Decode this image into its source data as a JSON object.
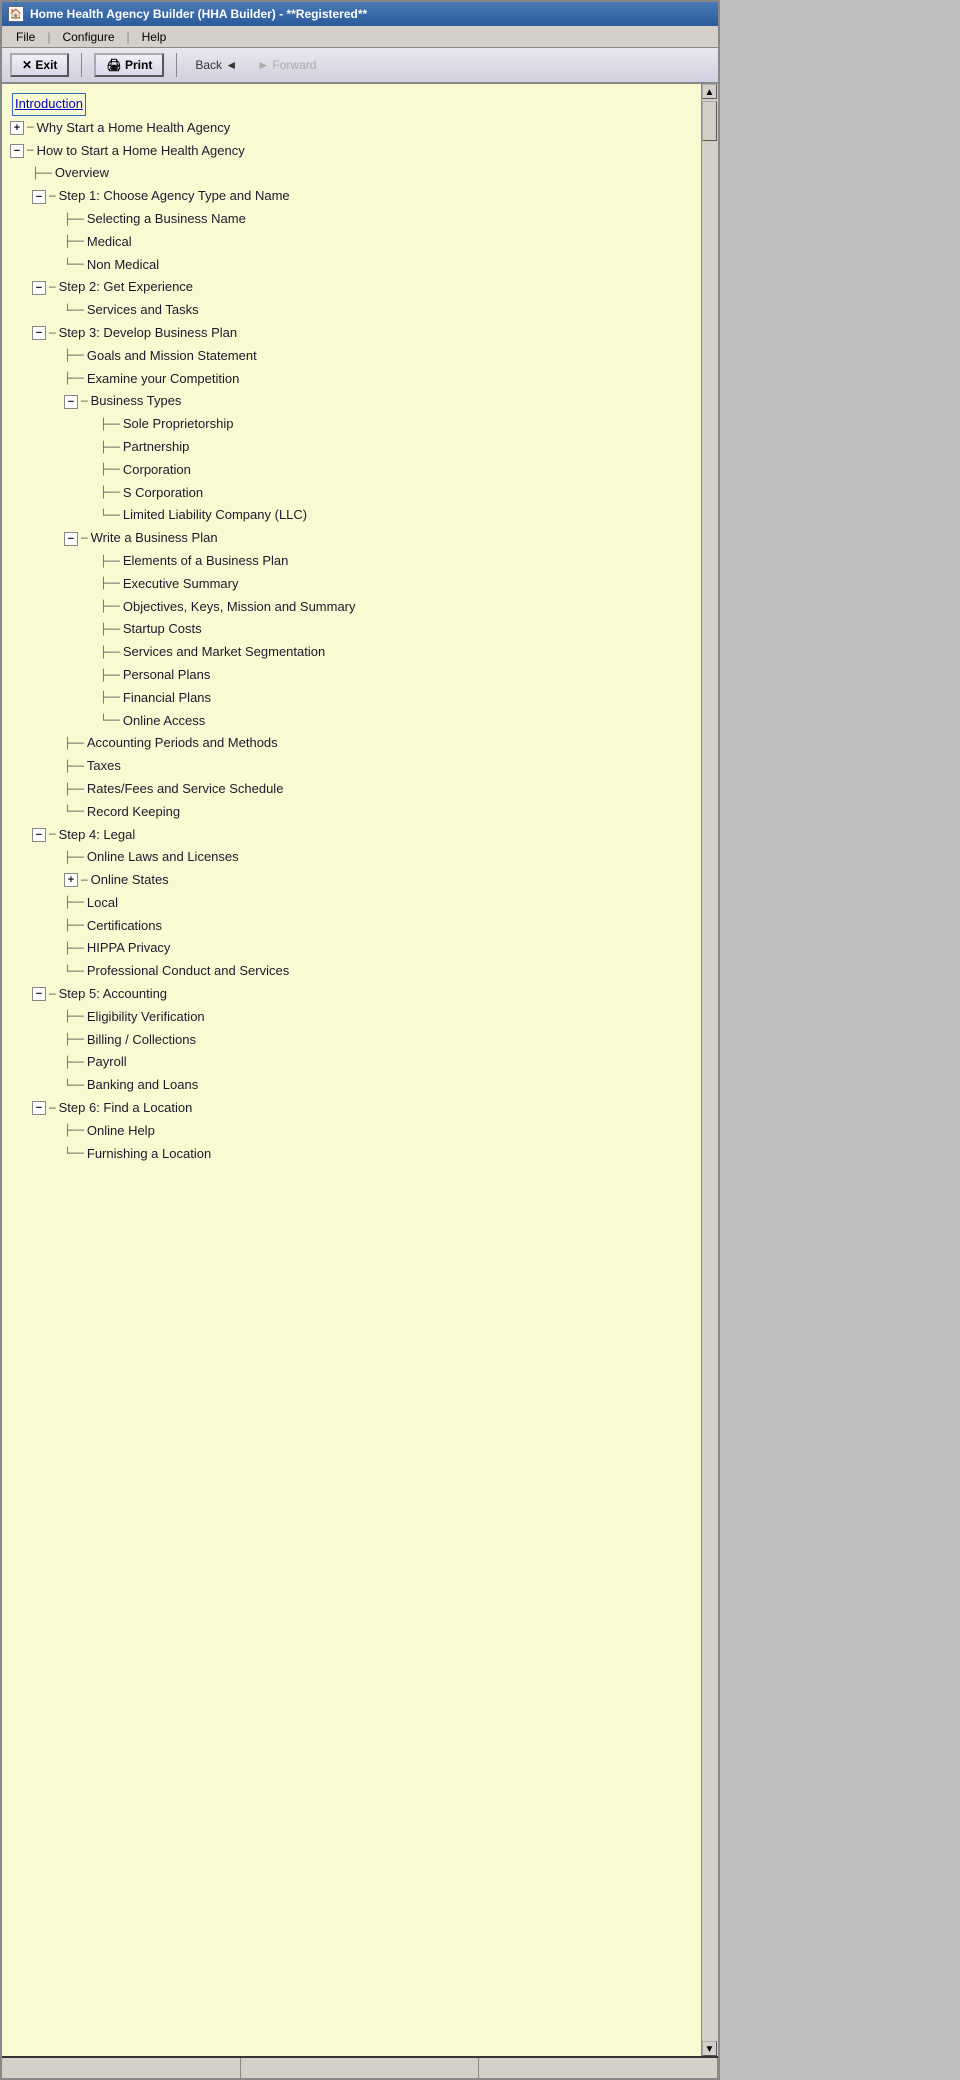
{
  "window": {
    "title": "Home Health Agency Builder (HHA Builder) - **Registered**",
    "icon": "🏠"
  },
  "menubar": {
    "items": [
      "File",
      "|",
      "Configure",
      "|",
      "Help"
    ]
  },
  "toolbar": {
    "exit_label": "✕ Exit",
    "print_label": "🖨 Print",
    "back_label": "Back ◄",
    "forward_label": "► Forward"
  },
  "tree": {
    "items": [
      {
        "id": "introduction",
        "label": "Introduction",
        "level": 0,
        "type": "link",
        "selected": true
      },
      {
        "id": "why-start",
        "label": "Why Start a Home Health Agency",
        "level": 0,
        "type": "collapsed-parent"
      },
      {
        "id": "how-start",
        "label": "How to Start a Home Health Agency",
        "level": 0,
        "type": "expanded-parent"
      },
      {
        "id": "overview",
        "label": "Overview",
        "level": 1,
        "type": "leaf"
      },
      {
        "id": "step1",
        "label": "Step 1: Choose Agency Type and Name",
        "level": 1,
        "type": "expanded-parent"
      },
      {
        "id": "selecting-name",
        "label": "Selecting a Business Name",
        "level": 2,
        "type": "leaf"
      },
      {
        "id": "medical",
        "label": "Medical",
        "level": 2,
        "type": "leaf"
      },
      {
        "id": "non-medical",
        "label": "Non Medical",
        "level": 2,
        "type": "leaf"
      },
      {
        "id": "step2",
        "label": "Step 2: Get Experience",
        "level": 1,
        "type": "expanded-parent"
      },
      {
        "id": "services-tasks",
        "label": "Services and Tasks",
        "level": 2,
        "type": "leaf"
      },
      {
        "id": "step3",
        "label": "Step 3: Develop Business Plan",
        "level": 1,
        "type": "expanded-parent"
      },
      {
        "id": "goals-mission",
        "label": "Goals and Mission Statement",
        "level": 2,
        "type": "leaf"
      },
      {
        "id": "examine-competition",
        "label": "Examine your Competition",
        "level": 2,
        "type": "leaf"
      },
      {
        "id": "business-types",
        "label": "Business Types",
        "level": 2,
        "type": "expanded-parent"
      },
      {
        "id": "sole-proprietorship",
        "label": "Sole Proprietorship",
        "level": 3,
        "type": "leaf"
      },
      {
        "id": "partnership",
        "label": "Partnership",
        "level": 3,
        "type": "leaf"
      },
      {
        "id": "corporation",
        "label": "Corporation",
        "level": 3,
        "type": "leaf"
      },
      {
        "id": "s-corporation",
        "label": "S Corporation",
        "level": 3,
        "type": "leaf"
      },
      {
        "id": "llc",
        "label": "Limited Liability Company (LLC)",
        "level": 3,
        "type": "leaf"
      },
      {
        "id": "write-business-plan",
        "label": "Write a Business Plan",
        "level": 2,
        "type": "expanded-parent"
      },
      {
        "id": "elements-business-plan",
        "label": "Elements of a Business Plan",
        "level": 3,
        "type": "leaf"
      },
      {
        "id": "executive-summary",
        "label": "Executive Summary",
        "level": 3,
        "type": "leaf"
      },
      {
        "id": "objectives",
        "label": "Objectives, Keys, Mission and Summary",
        "level": 3,
        "type": "leaf"
      },
      {
        "id": "startup-costs",
        "label": "Startup Costs",
        "level": 3,
        "type": "leaf"
      },
      {
        "id": "services-market",
        "label": "Services and Market Segmentation",
        "level": 3,
        "type": "leaf"
      },
      {
        "id": "personal-plans",
        "label": "Personal Plans",
        "level": 3,
        "type": "leaf"
      },
      {
        "id": "financial-plans",
        "label": "Financial Plans",
        "level": 3,
        "type": "leaf"
      },
      {
        "id": "online-access",
        "label": "Online Access",
        "level": 3,
        "type": "leaf"
      },
      {
        "id": "accounting-periods",
        "label": "Accounting Periods and Methods",
        "level": 2,
        "type": "leaf"
      },
      {
        "id": "taxes",
        "label": "Taxes",
        "level": 2,
        "type": "leaf"
      },
      {
        "id": "rates-fees",
        "label": "Rates/Fees and Service Schedule",
        "level": 2,
        "type": "leaf"
      },
      {
        "id": "record-keeping",
        "label": "Record Keeping",
        "level": 2,
        "type": "leaf"
      },
      {
        "id": "step4",
        "label": "Step 4: Legal",
        "level": 1,
        "type": "expanded-parent"
      },
      {
        "id": "online-laws",
        "label": "Online Laws and Licenses",
        "level": 2,
        "type": "leaf"
      },
      {
        "id": "online-states",
        "label": "Online States",
        "level": 2,
        "type": "collapsed-parent"
      },
      {
        "id": "local",
        "label": "Local",
        "level": 2,
        "type": "leaf"
      },
      {
        "id": "certifications",
        "label": "Certifications",
        "level": 2,
        "type": "leaf"
      },
      {
        "id": "hippa",
        "label": "HIPPA Privacy",
        "level": 2,
        "type": "leaf"
      },
      {
        "id": "professional-conduct",
        "label": "Professional Conduct and Services",
        "level": 2,
        "type": "leaf"
      },
      {
        "id": "step5",
        "label": "Step 5: Accounting",
        "level": 1,
        "type": "expanded-parent"
      },
      {
        "id": "eligibility",
        "label": "Eligibility Verification",
        "level": 2,
        "type": "leaf"
      },
      {
        "id": "billing",
        "label": "Billing / Collections",
        "level": 2,
        "type": "leaf"
      },
      {
        "id": "payroll",
        "label": "Payroll",
        "level": 2,
        "type": "leaf"
      },
      {
        "id": "banking",
        "label": "Banking and Loans",
        "level": 2,
        "type": "leaf"
      },
      {
        "id": "step6",
        "label": "Step 6: Find a Location",
        "level": 1,
        "type": "expanded-parent"
      },
      {
        "id": "online-help",
        "label": "Online Help",
        "level": 2,
        "type": "leaf"
      },
      {
        "id": "furnishing",
        "label": "Furnishing a Location",
        "level": 2,
        "type": "leaf"
      }
    ]
  },
  "status": {
    "panels": [
      "",
      "",
      ""
    ]
  }
}
